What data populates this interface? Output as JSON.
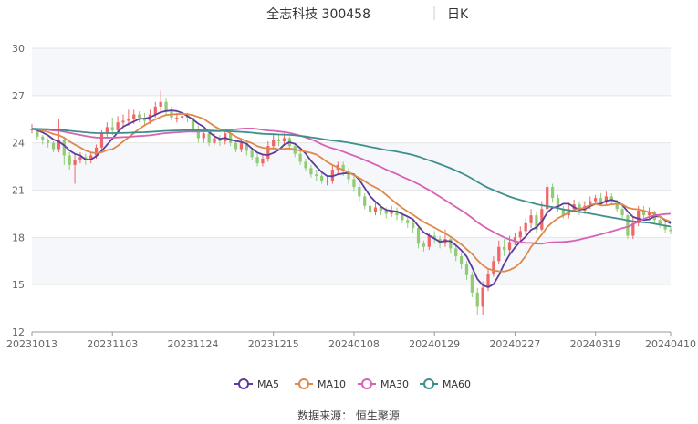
{
  "header": {
    "title": "全志科技 300458",
    "period": "日K"
  },
  "source_note": "数据来源： 恒生聚源",
  "colors": {
    "up": "#ee6666",
    "down": "#91cc75",
    "ma5": "#5d3c9b",
    "ma10": "#e0884a",
    "ma30": "#d662b5",
    "ma60": "#3e8f8c"
  },
  "chart_data": {
    "type": "candlestick",
    "y_axis": {
      "min": 12,
      "max": 30,
      "ticks": [
        12,
        15,
        18,
        21,
        24,
        27,
        30
      ]
    },
    "x_tick_labels": [
      "20231013",
      "20231103",
      "20231124",
      "20231215",
      "20240108",
      "20240129",
      "20240227",
      "20240319",
      "20240410"
    ],
    "x_tick_index": [
      0,
      15,
      30,
      45,
      60,
      75,
      90,
      105,
      119
    ],
    "legend": [
      "MA5",
      "MA10",
      "MA30",
      "MA60"
    ],
    "grid": true,
    "candles": [
      [
        24.8,
        24.9,
        25.2,
        24.6
      ],
      [
        24.8,
        24.4,
        24.9,
        24.2
      ],
      [
        24.4,
        24.2,
        24.5,
        23.9
      ],
      [
        24.2,
        24.0,
        24.3,
        23.7
      ],
      [
        24.0,
        23.6,
        24.1,
        23.4
      ],
      [
        23.6,
        24.2,
        25.5,
        23.4
      ],
      [
        24.2,
        23.2,
        24.4,
        22.6
      ],
      [
        23.2,
        22.6,
        23.4,
        22.3
      ],
      [
        22.6,
        22.9,
        23.3,
        21.4
      ],
      [
        22.9,
        23.1,
        23.4,
        22.7
      ],
      [
        23.1,
        22.9,
        23.3,
        22.6
      ],
      [
        22.9,
        23.2,
        23.4,
        22.7
      ],
      [
        23.2,
        23.7,
        23.9,
        23.0
      ],
      [
        23.7,
        24.6,
        24.8,
        23.5
      ],
      [
        24.6,
        25.0,
        25.3,
        24.3
      ],
      [
        25.0,
        24.8,
        25.6,
        24.5
      ],
      [
        24.8,
        25.3,
        25.7,
        24.6
      ],
      [
        25.3,
        25.4,
        25.8,
        25.0
      ],
      [
        25.4,
        25.5,
        26.1,
        25.1
      ],
      [
        25.5,
        25.8,
        26.1,
        25.2
      ],
      [
        25.8,
        25.6,
        26.0,
        25.3
      ],
      [
        25.6,
        25.4,
        25.9,
        25.1
      ],
      [
        25.4,
        25.8,
        26.1,
        25.2
      ],
      [
        25.8,
        26.3,
        26.6,
        25.6
      ],
      [
        26.3,
        26.6,
        27.3,
        26.0
      ],
      [
        26.6,
        26.0,
        26.8,
        25.7
      ],
      [
        26.0,
        25.6,
        26.3,
        25.4
      ],
      [
        25.6,
        25.6,
        25.9,
        25.3
      ],
      [
        25.6,
        25.7,
        25.9,
        25.4
      ],
      [
        25.7,
        25.6,
        25.9,
        25.3
      ],
      [
        25.6,
        24.9,
        25.8,
        24.6
      ],
      [
        24.9,
        24.3,
        25.1,
        24.0
      ],
      [
        24.3,
        24.6,
        24.9,
        24.0
      ],
      [
        24.6,
        24.0,
        24.8,
        23.8
      ],
      [
        24.0,
        24.3,
        24.6,
        23.9
      ],
      [
        24.3,
        24.1,
        24.5,
        23.8
      ],
      [
        24.1,
        24.6,
        24.8,
        23.9
      ],
      [
        24.6,
        24.0,
        24.7,
        23.8
      ],
      [
        24.0,
        23.6,
        24.2,
        23.4
      ],
      [
        23.6,
        24.0,
        24.2,
        23.4
      ],
      [
        24.0,
        23.5,
        24.1,
        23.2
      ],
      [
        23.5,
        23.1,
        23.7,
        22.9
      ],
      [
        23.1,
        22.7,
        23.3,
        22.5
      ],
      [
        22.7,
        23.0,
        23.3,
        22.5
      ],
      [
        23.0,
        23.8,
        24.1,
        22.8
      ],
      [
        23.8,
        24.2,
        24.5,
        23.6
      ],
      [
        24.2,
        24.1,
        24.5,
        23.8
      ],
      [
        24.1,
        24.3,
        24.6,
        23.9
      ],
      [
        24.3,
        23.8,
        24.4,
        23.5
      ],
      [
        23.8,
        23.3,
        24.0,
        23.1
      ],
      [
        23.3,
        22.8,
        23.5,
        22.6
      ],
      [
        22.8,
        22.4,
        23.0,
        22.2
      ],
      [
        22.4,
        22.0,
        22.6,
        21.8
      ],
      [
        22.0,
        21.9,
        22.3,
        21.6
      ],
      [
        21.9,
        21.6,
        22.1,
        21.4
      ],
      [
        21.6,
        21.6,
        21.9,
        21.3
      ],
      [
        21.6,
        22.3,
        22.6,
        21.4
      ],
      [
        22.3,
        22.6,
        22.8,
        22.0
      ],
      [
        22.6,
        22.2,
        22.8,
        21.9
      ],
      [
        22.2,
        21.7,
        22.4,
        21.4
      ],
      [
        21.7,
        21.2,
        21.9,
        20.9
      ],
      [
        21.2,
        20.6,
        21.4,
        20.3
      ],
      [
        20.6,
        20.0,
        20.8,
        19.8
      ],
      [
        20.0,
        19.6,
        20.2,
        19.3
      ],
      [
        19.6,
        19.9,
        20.2,
        19.4
      ],
      [
        19.9,
        19.7,
        20.1,
        19.4
      ],
      [
        19.7,
        19.5,
        19.9,
        19.2
      ],
      [
        19.5,
        19.7,
        20.0,
        19.3
      ],
      [
        19.7,
        19.4,
        19.9,
        19.1
      ],
      [
        19.4,
        19.1,
        19.6,
        18.9
      ],
      [
        19.1,
        18.9,
        19.3,
        18.6
      ],
      [
        18.9,
        18.6,
        19.1,
        18.3
      ],
      [
        18.6,
        17.6,
        18.7,
        17.3
      ],
      [
        17.6,
        17.4,
        17.8,
        17.1
      ],
      [
        17.4,
        18.1,
        18.3,
        17.2
      ],
      [
        18.1,
        17.9,
        18.4,
        17.6
      ],
      [
        17.9,
        17.6,
        18.1,
        17.3
      ],
      [
        17.6,
        17.9,
        18.5,
        17.4
      ],
      [
        17.9,
        17.3,
        18.1,
        17.0
      ],
      [
        17.3,
        16.8,
        17.5,
        16.5
      ],
      [
        16.8,
        16.3,
        17.0,
        16.0
      ],
      [
        16.3,
        15.6,
        16.5,
        15.3
      ],
      [
        15.6,
        14.5,
        15.8,
        14.2
      ],
      [
        14.5,
        13.6,
        14.8,
        13.1
      ],
      [
        13.6,
        14.8,
        15.2,
        13.1
      ],
      [
        14.8,
        15.7,
        16.0,
        14.6
      ],
      [
        15.7,
        16.5,
        16.8,
        15.5
      ],
      [
        16.5,
        17.4,
        17.8,
        16.3
      ],
      [
        17.4,
        17.2,
        17.9,
        16.8
      ],
      [
        17.2,
        17.7,
        18.1,
        17.0
      ],
      [
        17.7,
        18.0,
        18.3,
        17.5
      ],
      [
        18.0,
        18.4,
        18.7,
        17.8
      ],
      [
        18.4,
        18.9,
        19.2,
        18.1
      ],
      [
        18.9,
        19.4,
        19.8,
        18.6
      ],
      [
        19.4,
        18.5,
        19.6,
        18.3
      ],
      [
        18.5,
        19.8,
        20.3,
        18.4
      ],
      [
        19.8,
        21.2,
        21.4,
        19.6
      ],
      [
        21.2,
        20.5,
        21.4,
        20.2
      ],
      [
        20.5,
        19.8,
        20.7,
        19.6
      ],
      [
        19.8,
        19.4,
        20.0,
        19.2
      ],
      [
        19.4,
        19.8,
        20.2,
        19.2
      ],
      [
        19.8,
        20.1,
        20.4,
        19.6
      ],
      [
        20.1,
        19.7,
        20.3,
        19.4
      ],
      [
        19.7,
        20.0,
        20.3,
        19.5
      ],
      [
        20.0,
        20.3,
        20.6,
        19.8
      ],
      [
        20.3,
        20.5,
        20.7,
        20.1
      ],
      [
        20.5,
        20.2,
        20.8,
        20.0
      ],
      [
        20.2,
        20.6,
        20.9,
        20.0
      ],
      [
        20.6,
        20.3,
        20.8,
        20.1
      ],
      [
        20.3,
        19.8,
        20.4,
        19.6
      ],
      [
        19.8,
        19.4,
        20.0,
        19.2
      ],
      [
        19.4,
        18.1,
        19.5,
        17.9
      ],
      [
        18.1,
        18.9,
        19.3,
        17.9
      ],
      [
        18.9,
        19.7,
        20.0,
        18.7
      ],
      [
        19.7,
        19.4,
        20.0,
        19.2
      ],
      [
        19.4,
        19.6,
        19.9,
        19.1
      ],
      [
        19.6,
        19.1,
        19.7,
        18.9
      ],
      [
        19.1,
        18.8,
        19.2,
        18.6
      ],
      [
        18.8,
        18.5,
        19.0,
        18.3
      ],
      [
        18.5,
        18.4,
        18.7,
        18.2
      ]
    ]
  }
}
